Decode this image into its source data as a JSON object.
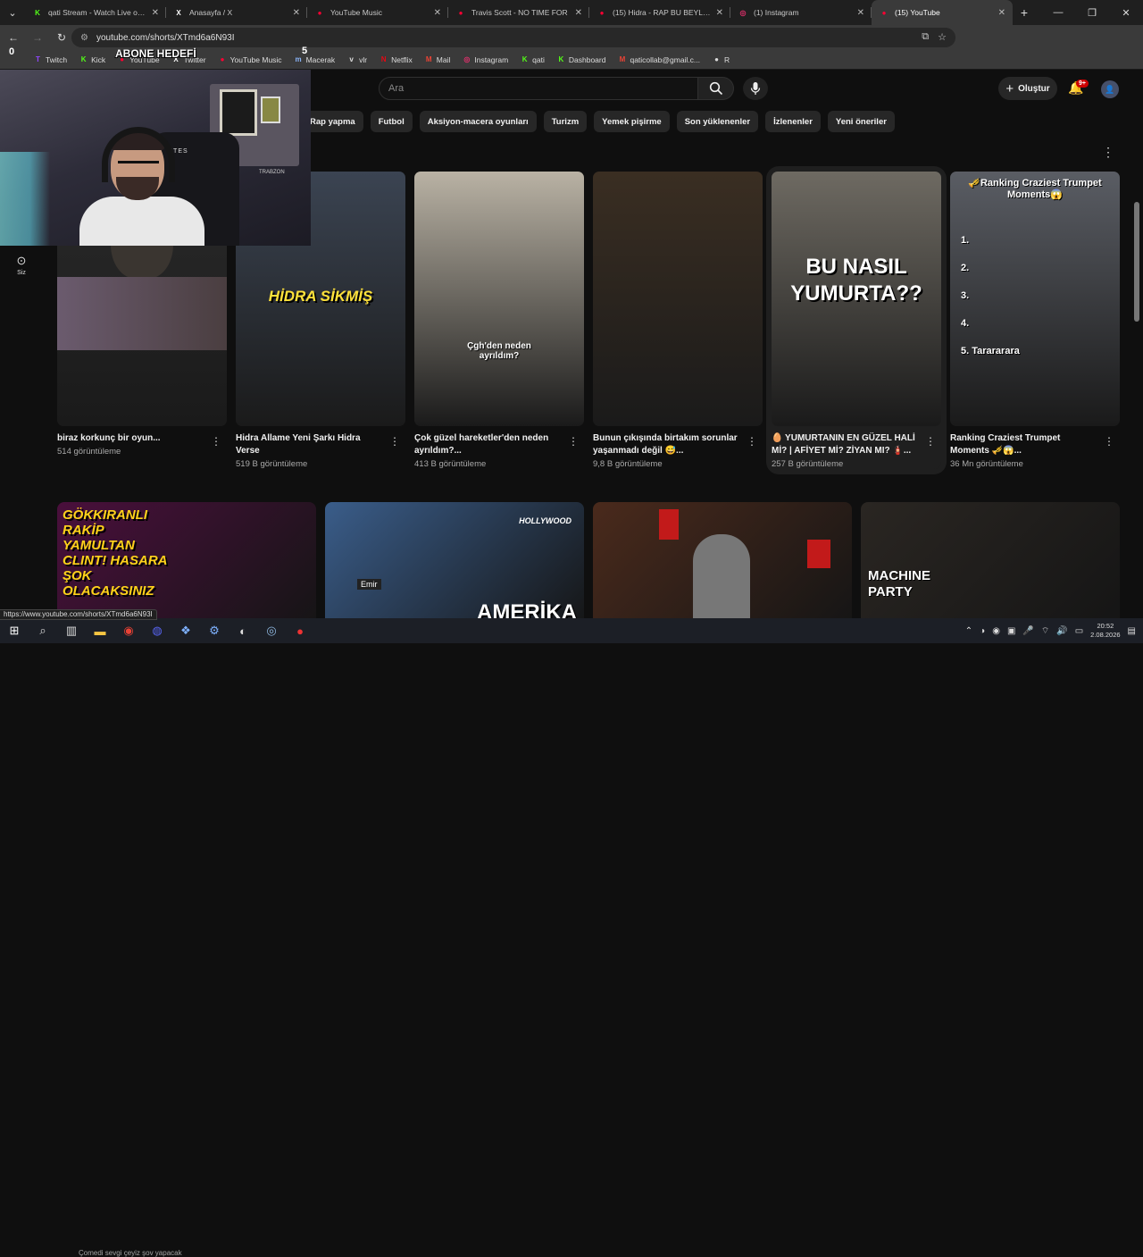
{
  "tabs": [
    {
      "title": "qati Stream - Watch Live on Ki",
      "fav": "K",
      "fav_color": "#53fc18",
      "active": false
    },
    {
      "title": "Anasayfa / X",
      "fav": "X",
      "fav_color": "#ffffff",
      "active": false
    },
    {
      "title": "YouTube Music",
      "fav": "●",
      "fav_color": "#ff0033",
      "active": false
    },
    {
      "title": "Travis Scott - NO TIME FOR",
      "fav": "●",
      "fav_color": "#ff0033",
      "active": false
    },
    {
      "title": "(15) Hidra - RAP BU BEYLER - Y",
      "fav": "●",
      "fav_color": "#ff0033",
      "active": false
    },
    {
      "title": "(1) Instagram",
      "fav": "◎",
      "fav_color": "#e1306c",
      "active": false
    },
    {
      "title": "(15) YouTube",
      "fav": "●",
      "fav_color": "#ff0033",
      "active": true
    }
  ],
  "address": {
    "url": "youtube.com/shorts/XTmd6a6N93I"
  },
  "bookmarks": [
    {
      "label": "Twitch",
      "icon": "T",
      "color": "#9146ff"
    },
    {
      "label": "Kick",
      "icon": "K",
      "color": "#53fc18"
    },
    {
      "label": "YouTube",
      "icon": "●",
      "color": "#ff0033"
    },
    {
      "label": "Twitter",
      "icon": "X",
      "color": "#ffffff"
    },
    {
      "label": "YouTube Music",
      "icon": "●",
      "color": "#ff0033"
    },
    {
      "label": "Macerak",
      "icon": "m",
      "color": "#8ab4f8"
    },
    {
      "label": "vlr",
      "icon": "v",
      "color": "#dddddd"
    },
    {
      "label": "Netflix",
      "icon": "N",
      "color": "#e50914"
    },
    {
      "label": "Mail",
      "icon": "M",
      "color": "#ea4335"
    },
    {
      "label": "Instagram",
      "icon": "◎",
      "color": "#e1306c"
    },
    {
      "label": "qati",
      "icon": "K",
      "color": "#53fc18"
    },
    {
      "label": "Dashboard",
      "icon": "K",
      "color": "#53fc18"
    },
    {
      "label": "qaticollab@gmail.c...",
      "icon": "M",
      "color": "#ea4335"
    },
    {
      "label": "R",
      "icon": "●",
      "color": "#dddddd"
    }
  ],
  "overlay": {
    "abone_label": "ABONE HEDEFİ",
    "left_count": "0",
    "right_count": "5"
  },
  "youtube": {
    "search_placeholder": "Ara",
    "create_label": "Oluştur",
    "notif_badge": "9+",
    "sidebar_you": "Siz",
    "chips": [
      "Rap yapma",
      "Futbol",
      "Aksiyon-macera oyunları",
      "Turizm",
      "Yemek pişirme",
      "Son yüklenenler",
      "İzlenenler",
      "Yeni öneriler"
    ],
    "shorts": [
      {
        "title": "biraz korkunç bir oyun...",
        "views": "514 görüntüleme",
        "thumb_text": "",
        "bg": "#2a2a2a"
      },
      {
        "title": "Hidra Allame Yeni Şarkı Hidra Verse",
        "views": "519 B görüntüleme",
        "thumb_text": "HİDRA SİKMİŞ",
        "bg": "#3b4452"
      },
      {
        "title": "Çok güzel hareketler'den neden ayrıldım?...",
        "views": "413 B görüntüleme",
        "thumb_text": "Çgh'den neden ayrıldım?",
        "bg": "#b9b2a4"
      },
      {
        "title": "Bunun çıkışında birtakım sorunlar yaşanmadı değil 😅...",
        "views": "9,8 B görüntüleme",
        "thumb_text": "",
        "bg": "#3a2e22"
      },
      {
        "title": "🥚 YUMURTANIN EN GÜZEL HALİ Mİ? | AFİYET Mİ? ZİYAN MI? 🧯...",
        "views": "257 B görüntüleme",
        "thumb_text": "BU NASIL YUMURTA??",
        "bg": "#6e6a62"
      },
      {
        "title": "Ranking Craziest Trumpet Moments 🎺😱...",
        "views": "36 Mn görüntüleme",
        "thumb_text": "🎺Ranking Craziest Trumpet Moments😱",
        "bg": "#5a5d64"
      }
    ],
    "trumpet_list": [
      "1.",
      "2.",
      "3.",
      "4.",
      "5. Tarararara"
    ],
    "videos": [
      {
        "thumb_text": "GÖKKIRANLI RAKİP YAMULTAN CLINT! HASARA ŞOK OLACAKSINIZ",
        "bg": "#4a0f3c"
      },
      {
        "thumb_text": "AMERİKA",
        "bg": "#3a5d8a"
      },
      {
        "thumb_text": "",
        "bg": "#4a2a1c"
      },
      {
        "thumb_text": "MACHINE PARTY",
        "bg": "#2a2622"
      }
    ],
    "lbl_hollywood": "HOLLYWOOD",
    "lbl_emir": "Emir"
  },
  "status_url": "https://www.youtube.com/shorts/XTmd6a6N93I",
  "taskbar": {
    "time": "20:52",
    "date": "2.08.2026",
    "overlay_text": "Çomedi sevgi çeyiz şov yapacak"
  },
  "webcam": {
    "headset_text": "NTES",
    "wall_text": "TRABZON"
  }
}
